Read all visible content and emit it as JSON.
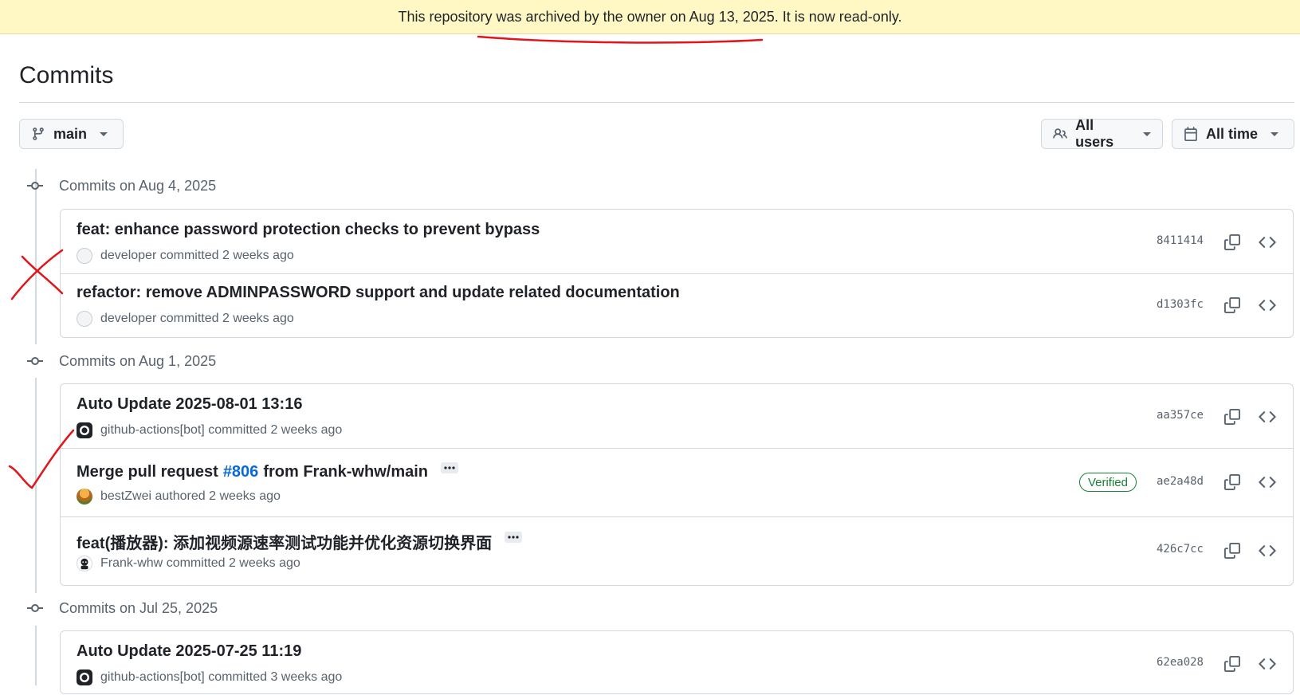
{
  "banner": {
    "text": "This repository was archived by the owner on Aug 13, 2025. It is now read-only."
  },
  "page": {
    "title": "Commits"
  },
  "toolbar": {
    "branch_label": "main",
    "users_label": "All users",
    "time_label": "All time"
  },
  "groups": [
    {
      "date": "Commits on Aug 4, 2025",
      "commits": [
        {
          "message": "feat: enhance password protection checks to prevent bypass",
          "author": "developer",
          "action": "committed",
          "time": "2 weeks ago",
          "sha": "8411414"
        },
        {
          "message": "refactor: remove ADMINPASSWORD support and update related documentation",
          "author": "developer",
          "action": "committed",
          "time": "2 weeks ago",
          "sha": "d1303fc"
        }
      ]
    },
    {
      "date": "Commits on Aug 1, 2025",
      "commits": [
        {
          "message": "Auto Update 2025-08-01 13:16",
          "author": "github-actions[bot]",
          "action": "committed",
          "time": "2 weeks ago",
          "sha": "aa357ce"
        },
        {
          "message_prefix": "Merge pull request",
          "message_link": "#806",
          "message_suffix": "from Frank-whw/main",
          "author": "bestZwei",
          "action": "authored",
          "time": "2 weeks ago",
          "sha": "ae2a48d",
          "badge": "Verified"
        },
        {
          "message": "feat(播放器): 添加视频源速率测试功能并优化资源切换界面",
          "author": "Frank-whw",
          "action": "committed",
          "time": "2 weeks ago",
          "sha": "426c7cc"
        }
      ]
    },
    {
      "date": "Commits on Jul 25, 2025",
      "commits": [
        {
          "message": "Auto Update 2025-07-25 11:19",
          "author": "github-actions[bot]",
          "action": "committed",
          "time": "3 weeks ago",
          "sha": "62ea028"
        }
      ]
    }
  ],
  "colors": {
    "accent": "#0969da",
    "verified": "#1a7f37",
    "banner_bg": "#fff8c5",
    "annotation": "#e0161a"
  }
}
